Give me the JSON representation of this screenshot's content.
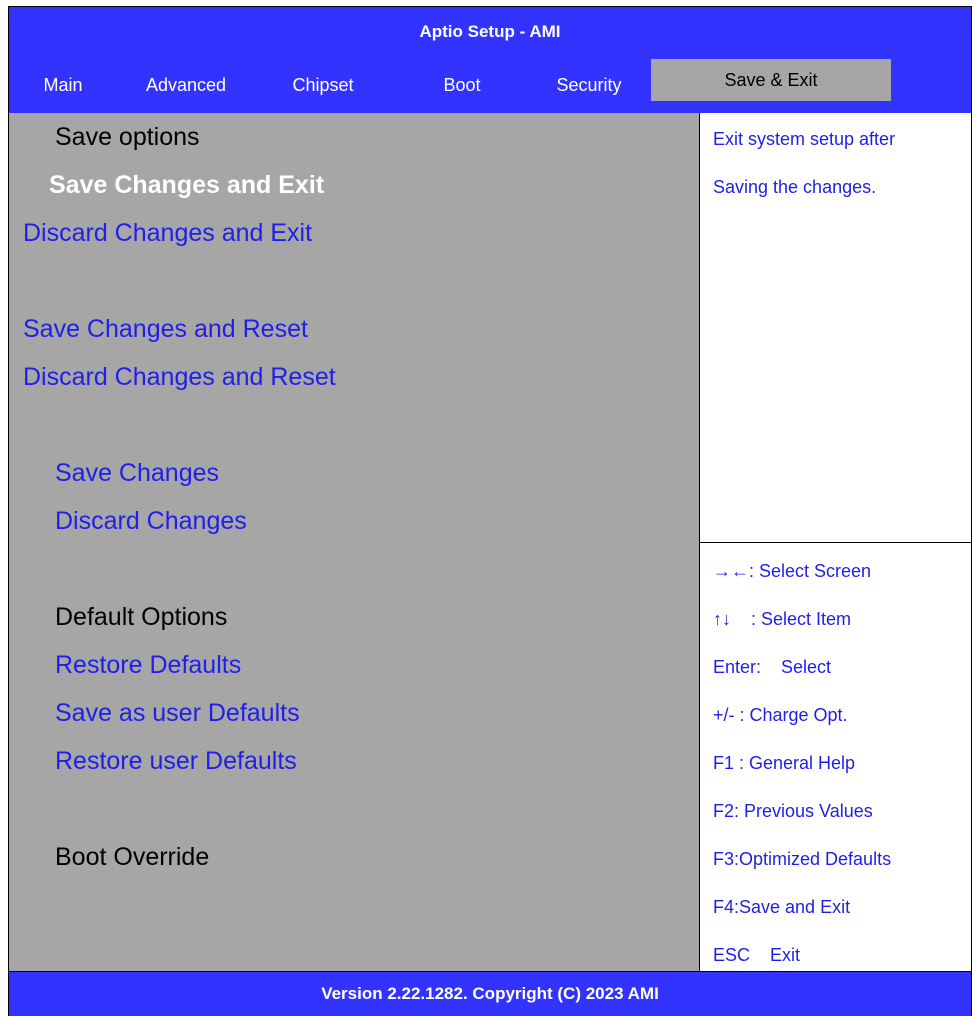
{
  "title": "Aptio Setup - AMI",
  "tabs": [
    "Main",
    "Advanced",
    "Chipset",
    "Boot",
    "Security",
    "Save & Exit"
  ],
  "menu": {
    "save_options_header": "Save options",
    "save_changes_and_exit": "Save Changes and Exit",
    "discard_changes_and_exit": "Discard Changes and Exit",
    "save_changes_and_reset": "Save Changes and Reset",
    "discard_changes_and_reset": "Discard Changes and Reset",
    "save_changes": "Save Changes",
    "discard_changes": "Discard Changes",
    "default_options_header": "Default Options",
    "restore_defaults": "Restore Defaults",
    "save_as_user_defaults": "Save as user Defaults",
    "restore_user_defaults": "Restore user Defaults",
    "boot_override_header": "Boot Override"
  },
  "help": {
    "line1": "Exit system setup after",
    "line2": "Saving the changes."
  },
  "keys": [
    "→←: Select Screen",
    "↑↓    : Select Item",
    "Enter:    Select",
    "+/- : Charge Opt.",
    "F1 : General Help",
    "F2: Previous Values",
    "F3:Optimized Defaults",
    "F4:Save and Exit",
    "ESC    Exit"
  ],
  "footer": "Version 2.22.1282. Copyright (C) 2023 AMI",
  "colors": {
    "header_blue": "#3333ff",
    "panel_gray": "#a6a6a6",
    "link_blue": "#1f1fe8",
    "selected_text": "#ffffff"
  }
}
